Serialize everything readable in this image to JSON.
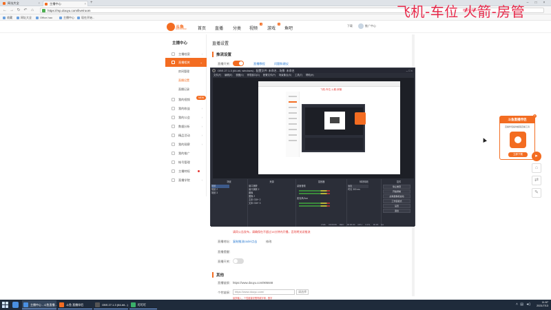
{
  "browser": {
    "tabs": [
      {
        "label": "网址大全",
        "active": false
      },
      {
        "label": "主播中心",
        "active": true
      }
    ],
    "url": "https://mp.douyu.com/live/room",
    "bookmarks": [
      "收藏",
      "网址大全",
      "Office.hao",
      "主播中心",
      "现在开始..."
    ]
  },
  "site": {
    "logo_text": "斗鱼",
    "logo_sub": "DOUYU.COM",
    "nav": [
      {
        "label": "首页"
      },
      {
        "label": "直播"
      },
      {
        "label": "分类"
      },
      {
        "label": "视频",
        "badge": "4"
      },
      {
        "label": "游戏",
        "badge": "5"
      },
      {
        "label": "鱼吧"
      }
    ],
    "header_right": [
      "下载",
      "推广中心"
    ]
  },
  "sidebar": {
    "title": "主播中心",
    "items": [
      {
        "label": "主播档案"
      },
      {
        "label": "直播相关",
        "active": true
      },
      {
        "label": "我的视频"
      },
      {
        "label": "我的收益"
      },
      {
        "label": "我的公会"
      },
      {
        "label": "数据分析"
      },
      {
        "label": "精品活动"
      },
      {
        "label": "我的观察"
      },
      {
        "label": "我的推广"
      },
      {
        "label": "帐号管理"
      },
      {
        "label": "主播特权"
      },
      {
        "label": "直播学院"
      }
    ],
    "subitems": [
      {
        "label": "房间管理",
        "selected": false
      },
      {
        "label": "直播设置",
        "selected": true
      },
      {
        "label": "直播记录",
        "selected": false
      }
    ],
    "new_tag": "NEW"
  },
  "main": {
    "title": "直播设置",
    "section1": "推流设置",
    "live_switch_label": "直播开关：",
    "link1": "直播教程",
    "link2": "问题和建议",
    "warning": "请同公告发布，请确保在不超过15分钟内开播，否则将关闭推流",
    "room_url_label": "直播地址：",
    "room_url_link": "复制推流code/点击",
    "copy_label": "修改",
    "announce_label": "直播提醒：",
    "low_delay_label": "直播开关：",
    "section2": "其他",
    "room_link_label": "直播链接：",
    "room_link_value": "https://www.douyu.com/905848",
    "custom_label": "个性链接：",
    "custom_placeholder": "https://www.douyu.com/",
    "custom_hint": "最多输入，个性链接仅限同款字母、数字",
    "custom_select": "请选择"
  },
  "obs": {
    "title": "OBS 27.1.3 (64-bit, windows) - 配置文件: 未命名 - 场景: 未命名",
    "menu": [
      "文件(F)",
      "编辑(E)",
      "视图(V)",
      "停靠窗口(D)",
      "配置文件(P)",
      "场景集合(S)",
      "工具(T)",
      "帮助(H)"
    ],
    "nested_red": "飞机-车位 火箭-房管",
    "docks": {
      "scenes": {
        "title": "场景",
        "items": [
          "场景",
          "场景 2",
          "场景 3"
        ]
      },
      "sources": {
        "title": "来源",
        "items": [
          "窗口捕获",
          "窗口捕获 2",
          "图像",
          "图像 2",
          "文本 GDI+ 2",
          "文本 GDI+ 3"
        ]
      },
      "mixer": {
        "title": "混音器",
        "items": [
          "桌面音频",
          "麦克风/Aux"
        ]
      },
      "transitions": {
        "title": "转场特效",
        "items": [
          "淡出",
          "时长",
          "300 ms"
        ]
      },
      "controls": {
        "title": "控件",
        "buttons": [
          "停止推流",
          "开始录制",
          "虚拟摄像机启动",
          "工作室模式",
          "设置",
          "退出"
        ]
      }
    },
    "status": [
      "LIVE: 00:00:09",
      "REC: 00:00:00",
      "CPU: 3.1%, 30.00 fps"
    ]
  },
  "stream_overlay": "飞机-车位  火箭-房管",
  "stream_overlay_small": "房管申请新人",
  "float_card": {
    "title": "斗鱼直播伴侣",
    "subtitle": "直播伴侣提供超强直播工具",
    "button": "立即下载"
  },
  "taskbar": {
    "apps": [
      "主播中心 - 斗鱼直播...",
      "斗鱼 直播伴侣",
      "OBS 27.1.3 (64-bit...)",
      "叮叮叮"
    ],
    "time": "11:57",
    "date": "2021/7/13"
  },
  "colors": {
    "accent": "#f36c21",
    "overlay": "#e8294a",
    "link": "#2a7ad1",
    "obs_bg": "#2b2e38",
    "taskbar": "#1f2b3b"
  }
}
